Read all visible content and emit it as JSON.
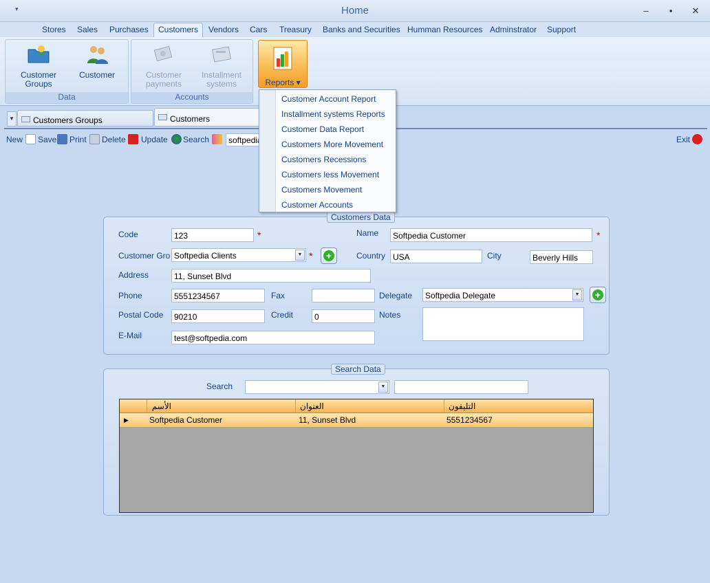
{
  "window": {
    "title": "Home",
    "qat_glyph": "▾",
    "minimize": "–",
    "maximize": "▪",
    "close": "✕"
  },
  "menu": {
    "items": [
      "Stores",
      "Sales",
      "Purchases",
      "Customers",
      "Vendors",
      "Cars",
      "Treasury",
      "Banks and Securities",
      "Humman Resources",
      "Adminstrator",
      "Support"
    ]
  },
  "ribbon": {
    "data_group": {
      "label": "Data",
      "customer_groups": "Customer\nGroups",
      "customer": "Customer"
    },
    "accounts_group": {
      "label": "Accounts",
      "customer_payments": "Customer\npayments",
      "installment_systems": "Installment\nsystems"
    },
    "reports_label": "Reports ▾"
  },
  "reports_menu": [
    "Customer Account Report",
    "Installment systems Reports",
    "Customer Data Report",
    "Customers More Movement",
    "Customers Recessions",
    "Customers less Movement",
    "Customers Movement",
    "Customer Accounts"
  ],
  "doc_tabs": {
    "arrow": "▼",
    "tab1": "Customers Groups",
    "tab2": "Customers"
  },
  "toolbar": {
    "new": "New",
    "save": "Save",
    "print": "Print",
    "delete": "Delete",
    "update": "Update",
    "search": "Search",
    "search_value": "softpedia",
    "exit": "Exit"
  },
  "customers_data": {
    "legend": "Customers Data",
    "code_label": "Code",
    "code_value": "123",
    "name_label": "Name",
    "name_value": "Softpedia Customer",
    "group_label": "Customer Grou",
    "group_value": "Softpedia Clients",
    "country_label": "Country",
    "country_value": "USA",
    "city_label": "City",
    "city_value": "Beverly Hills",
    "address_label": "Address",
    "address_value": "11, Sunset Blvd",
    "phone_label": "Phone",
    "phone_value": "5551234567",
    "fax_label": "Fax",
    "fax_value": "",
    "delegate_label": "Delegate",
    "delegate_value": "Softpedia Delegate",
    "postal_label": "Postal Code",
    "postal_value": "90210",
    "credit_label": "Credit",
    "credit_value": "0",
    "notes_label": "Notes",
    "email_label": "E-Mail",
    "email_value": "test@softpedia.com",
    "required_mark": "*",
    "dd_glyph": "▼",
    "add_glyph": "+"
  },
  "search_data": {
    "legend": "Search Data",
    "search_label": "Search",
    "columns": [
      "الأسم",
      "العنوان",
      "التليفون"
    ],
    "row": {
      "marker": "▶",
      "name": "Softpedia Customer",
      "address": "11, Sunset Blvd",
      "phone": "5551234567"
    }
  },
  "colors": {
    "accent_orange": "#f7a33a",
    "required_red": "#e00000",
    "title_blue": "#15428b"
  }
}
